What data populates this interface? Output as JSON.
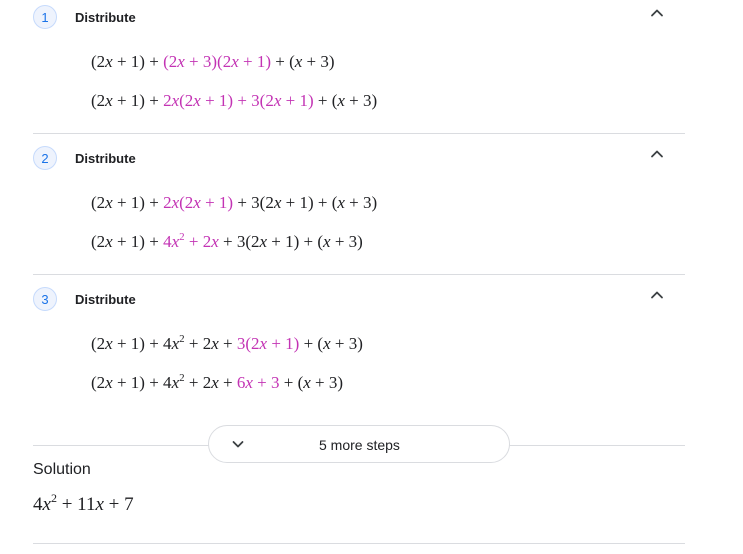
{
  "steps": [
    {
      "number": "1",
      "title": "Distribute",
      "line1": {
        "a": "(2x + 1) + ",
        "hl": "(2x + 3)(2x + 1)",
        "b": " + (x + 3)"
      },
      "line2": {
        "a": "(2x + 1) + ",
        "hl": "2x(2x + 1) + 3(2x + 1)",
        "b": " + (x + 3)"
      }
    },
    {
      "number": "2",
      "title": "Distribute",
      "line1": {
        "a": "(2x + 1) + ",
        "hl": "2x(2x + 1)",
        "b": " + 3(2x + 1) + (x + 3)"
      },
      "line2": {
        "a": "(2x + 1) + ",
        "hl_base": "4x",
        "hl_exp": "2",
        "hl_tail": " + 2x",
        "b": " + 3(2x + 1) + (x + 3)"
      }
    },
    {
      "number": "3",
      "title": "Distribute",
      "line1": {
        "a_base": "(2x + 1) + 4x",
        "a_exp": "2",
        "a_tail": " + 2x + ",
        "hl": "3(2x + 1)",
        "b": " + (x + 3)"
      },
      "line2": {
        "a_base": "(2x + 1) + 4x",
        "a_exp": "2",
        "a_tail": " + 2x + ",
        "hl": "6x + 3",
        "b": " + (x + 3)"
      }
    }
  ],
  "more_steps_label": "5 more steps",
  "solution": {
    "label": "Solution",
    "base": "4x",
    "exp": "2",
    "tail": " + 11x + 7"
  },
  "colors": {
    "highlight": "#c333b4",
    "accent": "#1a73e8",
    "divider": "#dadce0"
  },
  "icons": {
    "collapse": "chevron-up-icon",
    "expand": "chevron-down-icon"
  }
}
